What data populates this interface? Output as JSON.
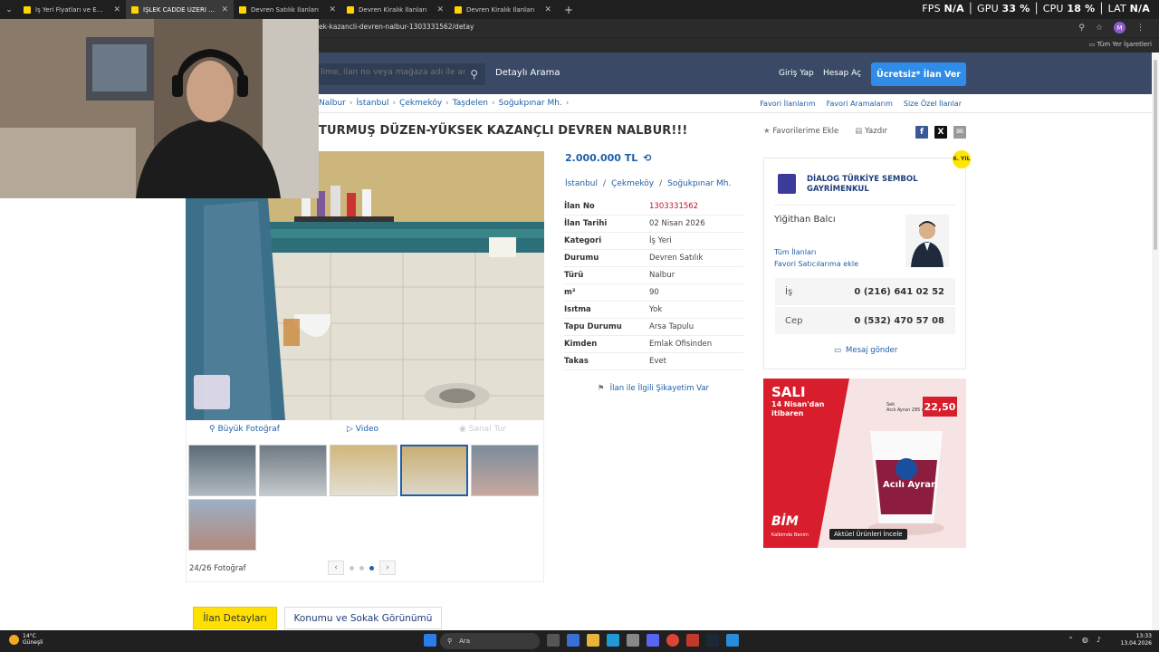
{
  "browser": {
    "tabs": [
      {
        "title": "İş Yeri Fiyatları ve Emlak İlanları",
        "active": false
      },
      {
        "title": "İŞLEK CADDE ÜZERİ OTURMUŞ",
        "active": true
      },
      {
        "title": "Devren Satılık İlanları",
        "active": false
      },
      {
        "title": "Devren Kiralık İlanları",
        "active": false
      },
      {
        "title": "Devren Kiralık İlanları",
        "active": false
      }
    ],
    "address": "ek-kazancli-devren-nalbur-1303331562/detay",
    "profile_initial": "M",
    "bookmarks_all": "Tüm Yer İşaretleri"
  },
  "hud": {
    "fps_label": "FPS",
    "fps": "N/A",
    "gpu_label": "GPU",
    "gpu": "33 %",
    "cpu_label": "CPU",
    "cpu": "18 %",
    "lat_label": "LAT",
    "lat": "N/A"
  },
  "header": {
    "search_placeholder": "lime, ilan no veya mağaza adı ile ara",
    "detailed_search": "Detaylı Arama",
    "login": "Giriş Yap",
    "register": "Hesap Aç",
    "post_ad": "Ücretsiz* İlan Ver"
  },
  "breadcrumb": [
    "Nalbur",
    "İstanbul",
    "Çekmeköy",
    "Taşdelen",
    "Soğukpınar Mh."
  ],
  "quick_links": {
    "favorites": "Favori İlanlarım",
    "searches": "Favori Aramalarım",
    "special": "Size Özel İlanlar"
  },
  "listing": {
    "title": "TURMUŞ DÜZEN-YÜKSEK KAZANÇLI DEVREN NALBUR!!!",
    "add_favorite": "Favorilerime Ekle",
    "print": "Yazdır",
    "price": "2.000.000 TL",
    "location": [
      "İstanbul",
      "Çekmeköy",
      "Soğukpınar Mh."
    ],
    "details": [
      {
        "label": "İlan No",
        "value": "1303331562"
      },
      {
        "label": "İlan Tarihi",
        "value": "02 Nisan 2026"
      },
      {
        "label": "Kategori",
        "value": "İş Yeri"
      },
      {
        "label": "Durumu",
        "value": "Devren Satılık"
      },
      {
        "label": "Türü",
        "value": "Nalbur"
      },
      {
        "label": "m²",
        "value": "90"
      },
      {
        "label": "Isıtma",
        "value": "Yok"
      },
      {
        "label": "Tapu Durumu",
        "value": "Arsa Tapulu"
      },
      {
        "label": "Kimden",
        "value": "Emlak Ofisinden"
      },
      {
        "label": "Takas",
        "value": "Evet"
      }
    ],
    "complaint": "İlan ile İlgili Şikayetim Var"
  },
  "gallery": {
    "big_photo": "Büyük Fotoğraf",
    "video": "Video",
    "virtual_tour": "Sanal Tur",
    "photo_count": "24/26 Fotoğraf"
  },
  "seller": {
    "badge": "6. YIL",
    "store_name": "DİALOG TÜRKİYE SEMBOL GAYRİMENKUL",
    "agent": "Yiğithan Balcı",
    "all_listings": "Tüm İlanları",
    "add_fav_seller": "Favori Satıcılarıma ekle",
    "phones": [
      {
        "label": "İş",
        "number": "0 (216) 641 02 52"
      },
      {
        "label": "Cep",
        "number": "0 (532) 470 57 08"
      }
    ],
    "message": "Mesaj gönder"
  },
  "ad": {
    "day": "SALI",
    "date": "14 Nisan'dan\nitibaren",
    "price": "22,50",
    "price_note": "Sek\nAcılı Ayran 285 ml",
    "product": "Acılı Ayran",
    "brand": "BİM",
    "brand_sub": "Kalbimde Benim",
    "cta": "Aktüel Ürünleri İncele"
  },
  "bottom_tabs": {
    "details": "İlan Detayları",
    "location": "Konumu ve Sokak Görünümü"
  },
  "taskbar": {
    "temp": "14°C",
    "weather": "Güneşli",
    "search": "Ara",
    "time": "13:33",
    "date": "13.04.2026"
  }
}
